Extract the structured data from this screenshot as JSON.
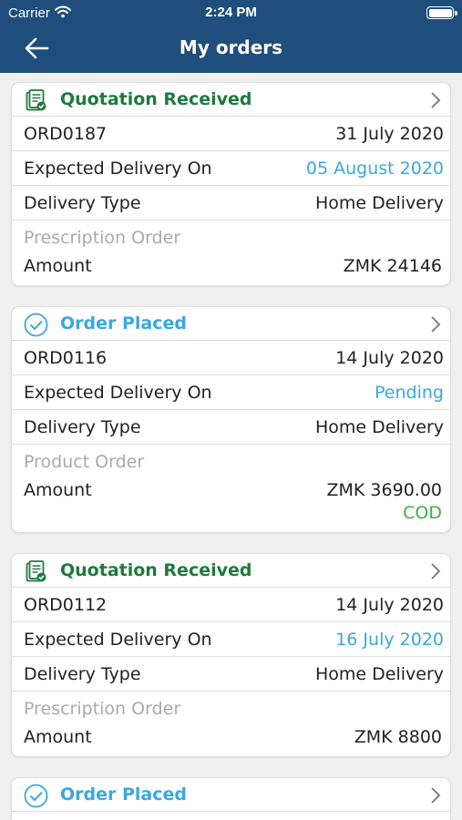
{
  "status_bar": {
    "carrier": "Carrier",
    "time": "2:24 PM",
    "wifi_icon": "wifi-icon",
    "battery_icon": "battery-icon"
  },
  "header": {
    "title": "My orders",
    "back_icon": "arrow-left-icon"
  },
  "colors": {
    "header_bg": "#1f4e7c",
    "quotation": "#1e7a3c",
    "placed": "#3aa7e0",
    "date_link": "#3aa7e0",
    "cod": "#3cb043",
    "muted": "#aaaaaa"
  },
  "orders": [
    {
      "status": "Quotation Received",
      "status_icon": "quotation-document-icon",
      "id": "ORD0187",
      "date": "31 July 2020",
      "expected_label": "Expected Delivery On",
      "expected_value": "05 August 2020",
      "delivery_label": "Delivery Type",
      "delivery_value": "Home Delivery",
      "order_type": "Prescription Order",
      "amount_label": "Amount",
      "amount_value": "ZMK 24146"
    },
    {
      "status": "Order Placed",
      "status_icon": "check-circle-icon",
      "id": "ORD0116",
      "date": "14 July 2020",
      "expected_label": "Expected Delivery On",
      "expected_value": "Pending",
      "delivery_label": "Delivery Type",
      "delivery_value": "Home Delivery",
      "order_type": "Product Order",
      "amount_label": "Amount",
      "amount_value": "ZMK 3690.00",
      "payment": "COD"
    },
    {
      "status": "Quotation Received",
      "status_icon": "quotation-document-icon",
      "id": "ORD0112",
      "date": "14 July 2020",
      "expected_label": "Expected Delivery On",
      "expected_value": "16 July 2020",
      "delivery_label": "Delivery Type",
      "delivery_value": "Home Delivery",
      "order_type": "Prescription Order",
      "amount_label": "Amount",
      "amount_value": "ZMK 8800"
    },
    {
      "status": "Order Placed",
      "status_icon": "check-circle-icon"
    }
  ]
}
